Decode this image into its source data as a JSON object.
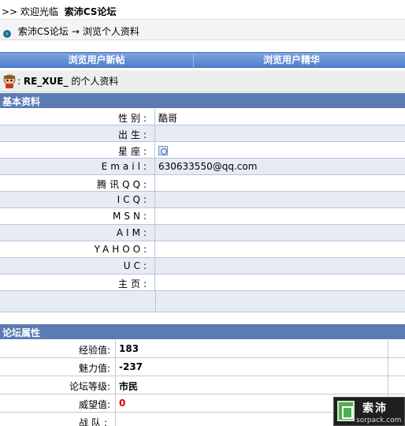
{
  "header": {
    "prefix": ">> 欢迎光临",
    "site_name": "索沛CS论坛"
  },
  "breadcrumb": {
    "forum": "索沛CS论坛",
    "arrow": "→",
    "current": "浏览个人资料"
  },
  "nav": {
    "posts": "浏览用户新帖",
    "digest": "浏览用户精华"
  },
  "user": {
    "prefix": ": ",
    "name": "RE_XUE_",
    "suffix": " 的个人资料"
  },
  "basic_section": {
    "title": "基本资料",
    "rows": [
      {
        "label": "性别:",
        "value": "酷哥"
      },
      {
        "label": "出生:",
        "value": ""
      },
      {
        "label": "星座:",
        "value": ""
      },
      {
        "label": "Email:",
        "value": "630633550@qq.com"
      },
      {
        "label": "腾讯QQ:",
        "value": ""
      },
      {
        "label": "ICQ:",
        "value": ""
      },
      {
        "label": "MSN:",
        "value": ""
      },
      {
        "label": "AIM:",
        "value": ""
      },
      {
        "label": "YAHOO:",
        "value": ""
      },
      {
        "label": "UC:",
        "value": ""
      },
      {
        "label": "主页:",
        "value": ""
      }
    ]
  },
  "forum_section": {
    "title": "论坛属性",
    "rows": [
      {
        "label": "经验值:",
        "value": "183"
      },
      {
        "label": "魅力值:",
        "value": "-237"
      },
      {
        "label": "论坛等级:",
        "value": "市民"
      },
      {
        "label": "威望值:",
        "value": "0"
      },
      {
        "label": "战队:",
        "value": ""
      }
    ]
  },
  "watermark": {
    "title": "索沛",
    "url": "sorpack.com"
  },
  "colors": {
    "accent": "#5b7bb5",
    "nav_bar": "#4f7fcf",
    "alt_row": "#e6ebf4",
    "danger": "#d40000"
  }
}
